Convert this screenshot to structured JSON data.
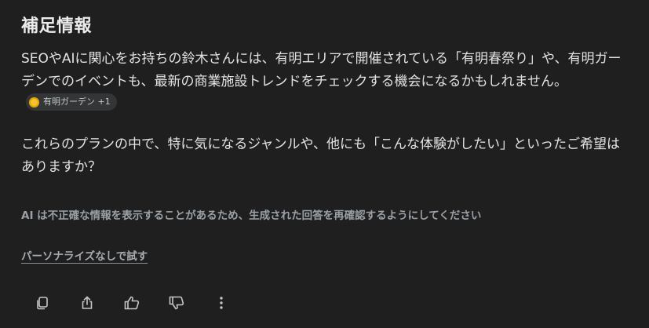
{
  "section": {
    "title": "補足情報"
  },
  "content": {
    "paragraph1": "SEOやAIに関心をお持ちの鈴木さんには、有明エリアで開催されている「有明春祭り」や、有明ガーデンでのイベントも、最新の商業施設トレンドをチェックする機会になるかもしれません。",
    "source_chip": {
      "label": "有明ガーデン +1",
      "icon": "site-favicon-icon"
    },
    "paragraph2": "これらのプランの中で、特に気になるジャンルや、他にも「こんな体験がしたい」といったご希望はありますか？"
  },
  "footer": {
    "disclaimer": "AI は不正確な情報を表示することがあるため、生成された回答を再確認するようにしてください",
    "personalize_link": "パーソナライズなしで試す"
  },
  "actions": {
    "icons": [
      "copy-icon",
      "share-icon",
      "thumbs-up-icon",
      "thumbs-down-icon",
      "more-vert-icon"
    ]
  }
}
